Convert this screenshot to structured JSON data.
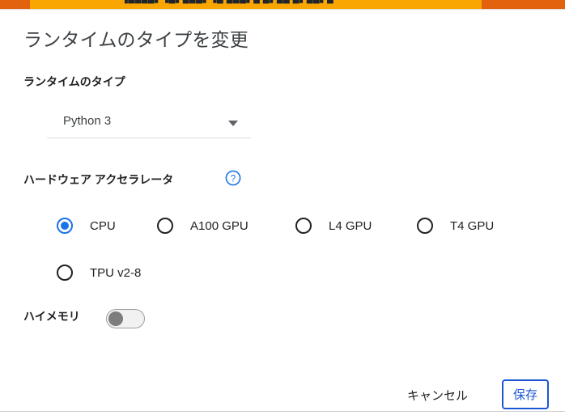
{
  "topbar": {
    "clipped_text": "▐███▄▖▗▄▖▄█▄▖▗▄ ▄█▄▖▄  ▄▖▄▄ ▄▖▄▄▖▄",
    "color_primary": "#e2620d",
    "color_accent": "#f9a602"
  },
  "dialog": {
    "title": "ランタイムのタイプを変更",
    "runtime_section": {
      "label": "ランタイムのタイプ",
      "select": {
        "name": "runtime-type-select",
        "value": "Python 3",
        "options": [
          "Python 3"
        ]
      }
    },
    "accelerator_section": {
      "label": "ハードウェア アクセラレータ",
      "help_icon": "help-circle-icon",
      "help_icon_color": "#1a73e8",
      "options": [
        {
          "label": "CPU",
          "checked": true
        },
        {
          "label": "A100 GPU",
          "checked": false
        },
        {
          "label": "L4 GPU",
          "checked": false
        },
        {
          "label": "T4 GPU",
          "checked": false
        },
        {
          "label": "TPU v2-8",
          "checked": false
        }
      ],
      "selected_color": "#1a73e8"
    },
    "high_memory_section": {
      "label": "ハイメモリ",
      "toggle_state": "off"
    },
    "footer": {
      "cancel_label": "キャンセル",
      "save_label": "保存",
      "save_accent_color": "#1a56d6"
    }
  }
}
